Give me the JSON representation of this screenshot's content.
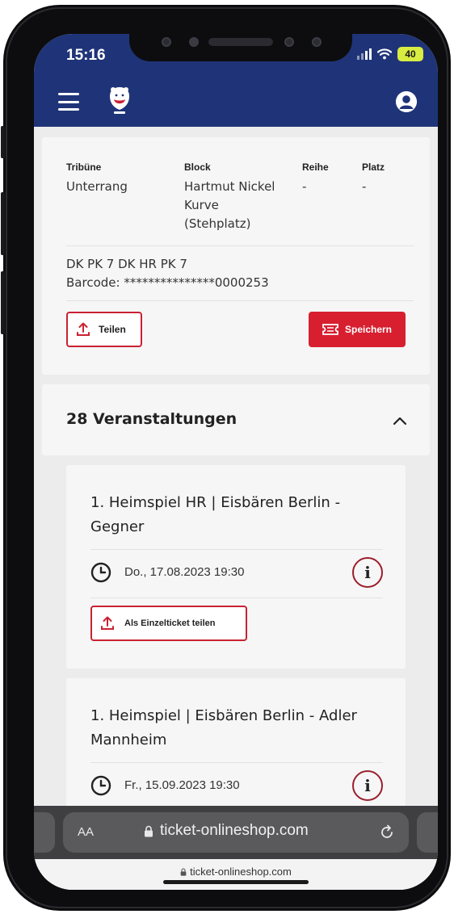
{
  "status_bar": {
    "time": "15:16",
    "battery": "40"
  },
  "app_header": {
    "menu_icon": "hamburger-menu-icon",
    "logo_icon": "polar-bear-crest-icon",
    "profile_icon": "user-profile-icon"
  },
  "ticket": {
    "labels": {
      "tribune": "Tribüne",
      "block": "Block",
      "row": "Reihe",
      "seat": "Platz"
    },
    "values": {
      "tribune": "Unterrang",
      "block_lines": [
        "Hartmut Nickel",
        "Kurve",
        "(Stehplatz)"
      ],
      "row": "-",
      "seat": "-"
    },
    "codes": "DK PK 7 DK HR PK 7",
    "barcode": "Barcode: ***************0000253",
    "share_label": "Teilen",
    "save_label": "Speichern"
  },
  "events": {
    "title": "28 Veranstaltungen",
    "items": [
      {
        "title": "1. Heimspiel HR | Eisbären Berlin - Gegner",
        "date": "Do., 17.08.2023 19:30",
        "share_label": "Als Einzelticket teilen"
      },
      {
        "title": "1. Heimspiel | Eisbären Berlin - Adler Mannheim",
        "date": "Fr., 15.09.2023 19:30"
      }
    ]
  },
  "browser": {
    "aa_label": "AA",
    "url": "ticket-onlineshop.com",
    "bottom_url": "ticket-onlineshop.com"
  },
  "colors": {
    "header_blue": "#1f3478",
    "accent_red": "#d71f30",
    "background": "#ececed"
  }
}
